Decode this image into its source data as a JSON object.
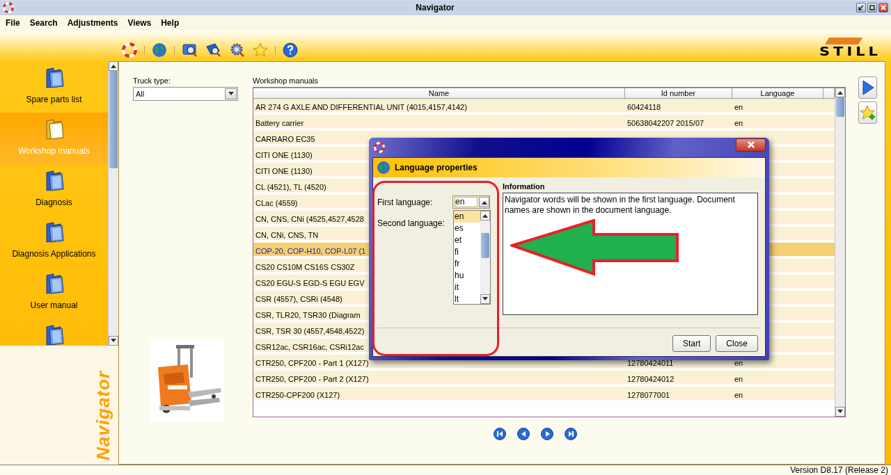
{
  "window": {
    "title": "Navigator"
  },
  "menu": [
    "File",
    "Search",
    "Adjustments",
    "Views",
    "Help"
  ],
  "logo": "STILL",
  "sidebar": {
    "items": [
      {
        "label": "Spare parts list",
        "selected": false
      },
      {
        "label": "Workshop manuals",
        "selected": true
      },
      {
        "label": "Diagnosis",
        "selected": false
      },
      {
        "label": "Diagnosis Applications",
        "selected": false
      },
      {
        "label": "User manual",
        "selected": false
      },
      {
        "selected": false
      }
    ],
    "brand": "Navigator"
  },
  "filter": {
    "label": "Truck type:",
    "value": "All"
  },
  "table": {
    "title": "Workshop manuals",
    "columns": [
      "Name",
      "Id number",
      "Language"
    ],
    "rows": [
      {
        "name": "AR 274 G AXLE AND DIFFERENTIAL UNIT (4015,4157,4142)",
        "id": "60424118",
        "language": "en",
        "selected": false
      },
      {
        "name": "Battery carrier",
        "id": "50638042207  2015/07",
        "language": "en",
        "selected": false
      },
      {
        "name": "CARRARO EC35",
        "selected": false
      },
      {
        "name": "CITI ONE (1130)",
        "selected": false
      },
      {
        "name": "CITI ONE (1130)",
        "selected": false
      },
      {
        "name": "CL (4521), TL (4520)",
        "selected": false
      },
      {
        "name": "CLac (4559)",
        "selected": false
      },
      {
        "name": "CN, CNS, CNi (4525,4527,4528",
        "selected": false
      },
      {
        "name": "CN, CNi, CNS, TN",
        "selected": false
      },
      {
        "name": "COP-20, COP-H10, COP-L07 (1",
        "selected": true
      },
      {
        "name": "CS20 CS10M CS16S CS30Z",
        "selected": false
      },
      {
        "name": "CS20 EGU-S EGD-S EGU EGV",
        "selected": false
      },
      {
        "name": "CSR (4557), CSRi (4548)",
        "selected": false
      },
      {
        "name": "CSR, TLR20, TSR30 (Diagram",
        "selected": false
      },
      {
        "name": "CSR, TSR 30 (4557,4548,4522)",
        "selected": false
      },
      {
        "name": "CSR12ac, CSR16ac, CSRi12ac",
        "selected": false
      },
      {
        "name": "CTR250, CPF200 - Part 1 (X127)",
        "id": "12780424011",
        "language": "en",
        "selected": false
      },
      {
        "name": "CTR250, CPF200 - Part 2 (X127)",
        "id": "12780424012",
        "language": "en",
        "selected": false
      },
      {
        "name": "CTR250-CPF200 (X127)",
        "id": "1278077001",
        "language": "en",
        "selected": false
      }
    ]
  },
  "dialog": {
    "header": "Language properties",
    "first_language": {
      "label": "First language:",
      "value": "en",
      "expanded": true,
      "options": [
        {
          "label": "en",
          "selected": true
        },
        {
          "label": "es",
          "selected": false
        },
        {
          "label": "et",
          "selected": false
        },
        {
          "label": "fi",
          "selected": false
        },
        {
          "label": "fr",
          "selected": false
        },
        {
          "label": "hu",
          "selected": false
        },
        {
          "label": "it",
          "selected": false
        },
        {
          "label": "lt",
          "selected": false
        }
      ]
    },
    "second_language": {
      "label": "Second language:"
    },
    "information": {
      "title": "Information",
      "text": "Navigator words will be shown in the first language. Document names are shown in the document language."
    },
    "buttons": [
      "Start",
      "Close"
    ]
  },
  "status_bar": "Version D8.17 (Release 2)"
}
